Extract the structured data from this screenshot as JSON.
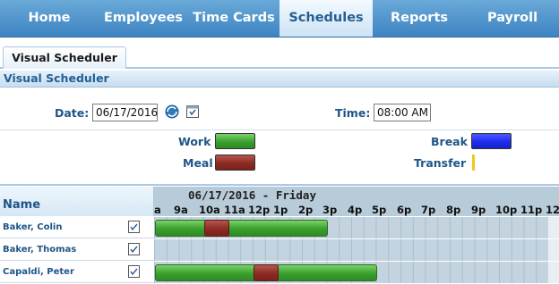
{
  "nav": {
    "items": [
      {
        "label": "Home",
        "active": false
      },
      {
        "label": "Employees",
        "active": false
      },
      {
        "label": "Time Cards",
        "active": false
      },
      {
        "label": "Schedules",
        "active": true
      },
      {
        "label": "Reports",
        "active": false
      },
      {
        "label": "Payroll",
        "active": false
      }
    ]
  },
  "tabs": {
    "active_label": "Visual Scheduler"
  },
  "section": {
    "title": "Visual Scheduler"
  },
  "filters": {
    "date_label": "Date:",
    "date_value": "06/17/2016",
    "time_label": "Time:",
    "time_value": "08:00 AM",
    "icons": [
      "globe-refresh-icon",
      "calendar-icon"
    ]
  },
  "legend": {
    "work": {
      "label": "Work",
      "color": "#3aa02e"
    },
    "meal": {
      "label": "Meal",
      "color": "#8b2b24"
    },
    "break": {
      "label": "Break",
      "color": "#1f2cf0"
    },
    "transfer": {
      "label": "Transfer",
      "color": "#f2c81b"
    }
  },
  "grid": {
    "name_header": "Name",
    "date_title": "06/17/2016 - Friday",
    "hours": [
      "a",
      "9a",
      "10a",
      "11a",
      "12p",
      "1p",
      "2p",
      "3p",
      "4p",
      "5p",
      "6p",
      "7p",
      "8p",
      "9p",
      "10p",
      "11p",
      "12"
    ],
    "rows": [
      {
        "name": "Baker, Colin",
        "work_start": "8:00 AM",
        "work_end": "3:00 PM",
        "meal_start": "10:00 AM",
        "meal_end": "11:00 AM"
      },
      {
        "name": "Baker, Thomas"
      },
      {
        "name": "Capaldi, Peter",
        "work_start": "8:00 AM",
        "work_end": "5:00 PM",
        "meal_start": "12:00 PM",
        "meal_end": "1:00 PM"
      }
    ]
  }
}
